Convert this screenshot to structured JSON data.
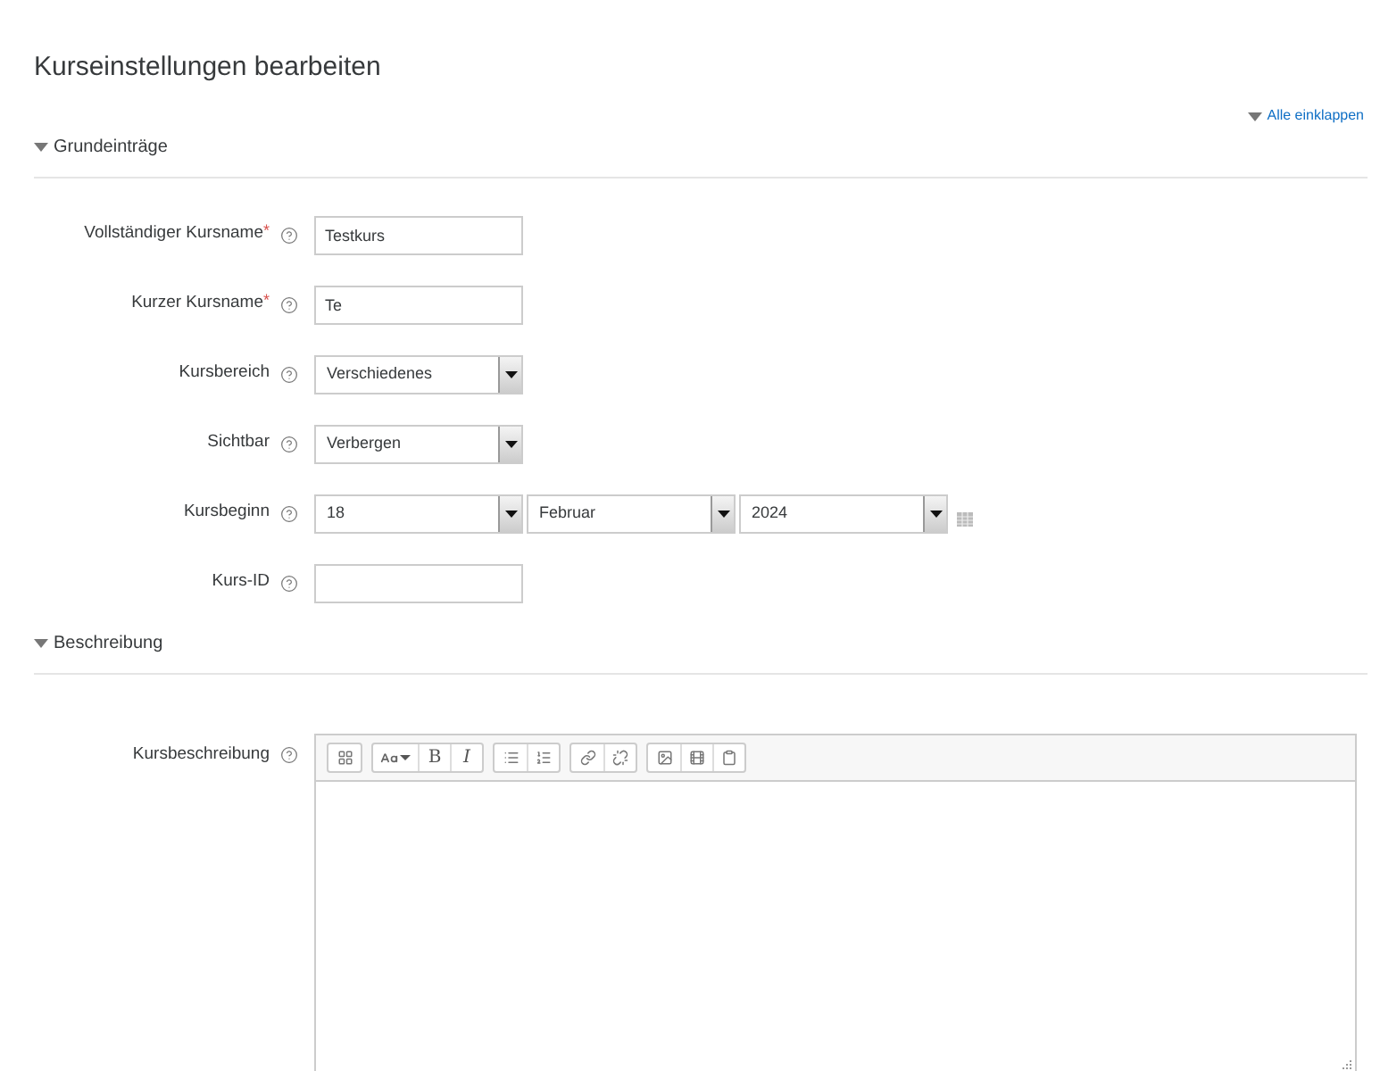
{
  "page_title": "Kurseinstellungen bearbeiten",
  "collapse_all": "Alle einklappen",
  "sections": [
    {
      "title": "Grundeinträge",
      "expanded": true,
      "fields": [
        {
          "kind": "text",
          "label": "Vollständiger Kursname",
          "required_mark": "*",
          "value": "Testkurs"
        },
        {
          "kind": "text",
          "label": "Kurzer Kursname",
          "required_mark": "*",
          "value": "Te"
        },
        {
          "kind": "select",
          "label": "Kursbereich",
          "value": "Verschiedenes"
        },
        {
          "kind": "select",
          "label": "Sichtbar",
          "value": "Verbergen"
        },
        {
          "kind": "date",
          "label": "Kursbeginn",
          "day": "18",
          "month": "Februar",
          "year": "2024"
        },
        {
          "kind": "text",
          "label": "Kurs-ID"
        }
      ]
    },
    {
      "title": "Beschreibung",
      "expanded": true,
      "fields": [
        {
          "kind": "editor",
          "label": "Kursbeschreibung",
          "toolbar": [
            [
              {
                "kind": "icon"
              }
            ],
            [
              {
                "kind": "icon"
              },
              {
                "kind": "bold",
                "label": "B"
              },
              {
                "kind": "italic",
                "label": "I"
              }
            ],
            [
              {
                "kind": "icon"
              },
              {
                "kind": "icon"
              }
            ],
            [
              {
                "kind": "icon"
              },
              {
                "kind": "icon"
              }
            ],
            [
              {
                "kind": "icon"
              },
              {
                "kind": "icon"
              },
              {
                "kind": "icon"
              }
            ]
          ]
        }
      ]
    }
  ]
}
